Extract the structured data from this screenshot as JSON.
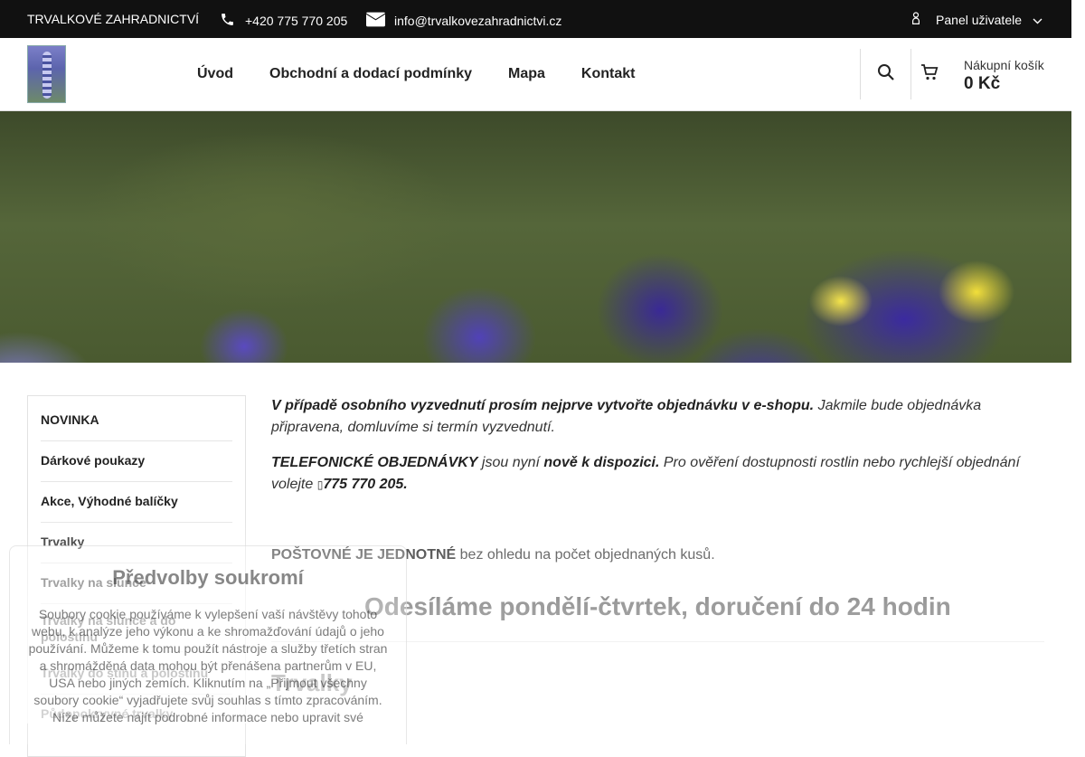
{
  "topbar": {
    "brand": "TRVALKOVÉ ZAHRADNICTVÍ",
    "phone": "+420 775 770 205",
    "email": "info@trvalkovezahradnictvi.cz",
    "panel_label": "Panel uživatele"
  },
  "nav": {
    "items": [
      "Úvod",
      "Obchodní a dodací podmínky",
      "Mapa",
      "Kontakt"
    ]
  },
  "cart": {
    "label": "Nákupní košík",
    "value": "0 Kč"
  },
  "sidebar": {
    "items": [
      "NOVINKA",
      "Dárkové poukazy",
      "Akce, Výhodné balíčky",
      "Trvalky",
      "Trvalky na slunce",
      "Trvalky na slunce a do polostínu",
      "Trvalky do stínu a polostínu",
      "Půdopokryvné trvalky"
    ]
  },
  "content": {
    "p1_bold": "V případě osobního vyzvednutí prosím nejprve vytvořte objednávku v e-shopu.",
    "p1_rest": " Jakmile bude objednávka připravena, domluvíme si termín vyzvednutí.",
    "p2_a": "TELEFONICKÉ OBJEDNÁVKY",
    "p2_b": " jsou nyní ",
    "p2_c": "nově k dispozici.",
    "p2_d": " Pro ověření dostupnosti rostlin nebo rychlejší objednání volejte ",
    "p2_phone": "775 770 205.",
    "p3_bold": "POŠTOVNÉ JE JEDNOTNÉ",
    "p3_rest": " bez ohledu na počet objednaných kusů.",
    "h2": "Odesíláme pondělí-čtvrtek, doručení do 24 hodin",
    "h1": "Trvalky"
  },
  "privacy": {
    "title": "Předvolby soukromí",
    "text": "Soubory cookie používáme k vylepšení vaší návštěvy tohoto webu, k analýze jeho výkonu a ke shromažďování údajů o jeho používání. Můžeme k tomu použít nástroje a služby třetích stran a shromážděná data mohou být přenášena partnerům v EU, USA nebo jiných zemích. Kliknutím na „Přijmout všechny soubory cookie“ vyjadřujete svůj souhlas s tímto zpracováním. Níže můžete najít podrobné informace nebo upravit své"
  },
  "icons": [
    "phone-icon",
    "envelope-icon",
    "user-icon",
    "chevron-down-icon",
    "search-icon",
    "cart-icon"
  ]
}
